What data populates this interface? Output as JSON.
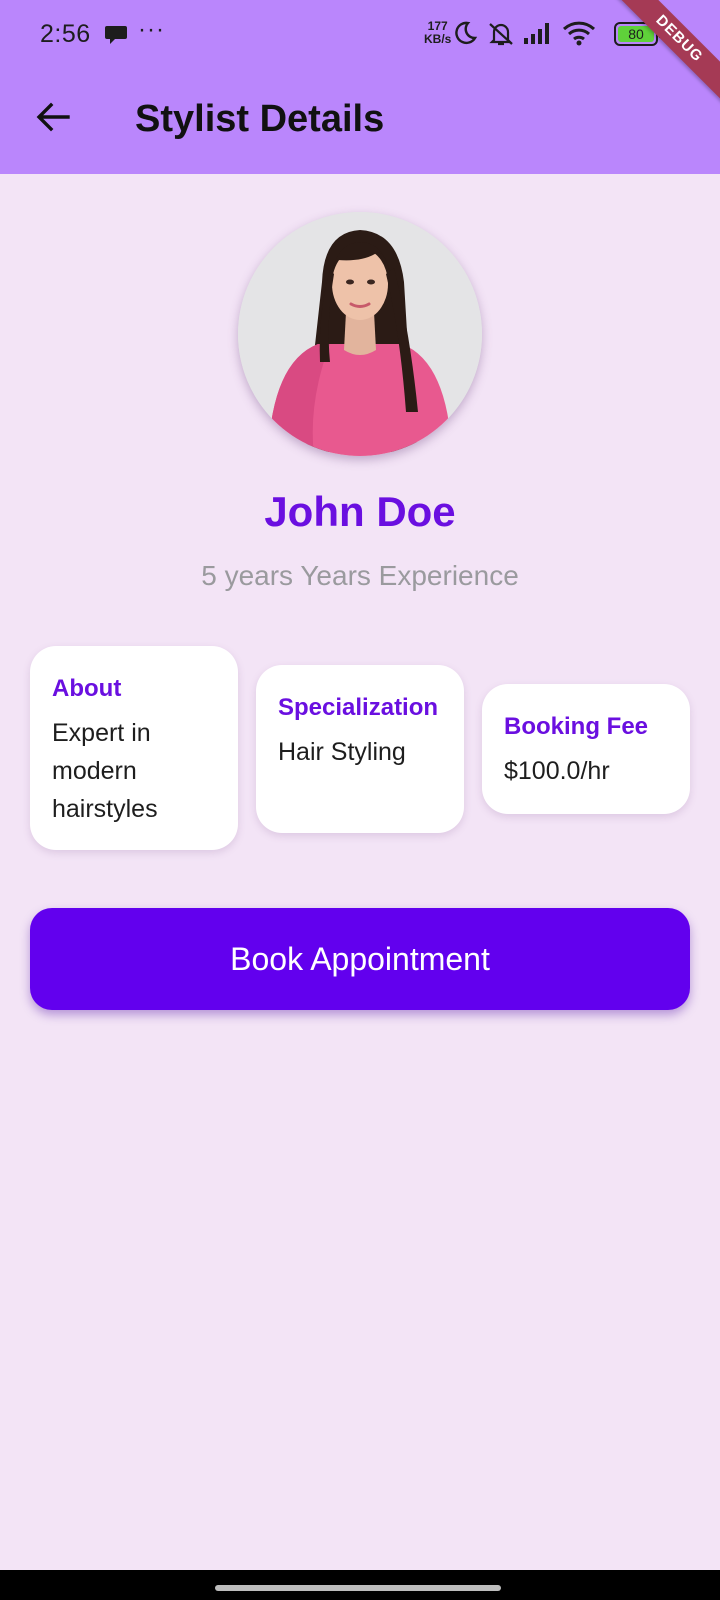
{
  "status_bar": {
    "time": "2:56",
    "dots": "···",
    "speed_value": "177",
    "speed_unit": "KB/s",
    "battery": "80",
    "icons": [
      "message-icon",
      "moon-icon",
      "bell-off-icon",
      "signal-icon",
      "wifi-icon",
      "battery-icon"
    ]
  },
  "debug_banner": "DEBUG",
  "app_bar": {
    "title": "Stylist Details",
    "back_icon": "arrow-left-icon"
  },
  "stylist": {
    "name": "John Doe",
    "experience": "5 years Years Experience"
  },
  "cards": {
    "about": {
      "heading": "About",
      "value": "Expert in modern hairstyles"
    },
    "specialization": {
      "heading": "Specialization",
      "value": "Hair Styling"
    },
    "fee": {
      "heading": "Booking Fee",
      "value": "$100.0/hr"
    }
  },
  "actions": {
    "book_label": "Book Appointment"
  },
  "colors": {
    "app_bar": "#ba86fc",
    "background": "#f3e4f6",
    "accent": "#6a0fe0",
    "button": "#6200ee",
    "debug": "#a53a55"
  }
}
